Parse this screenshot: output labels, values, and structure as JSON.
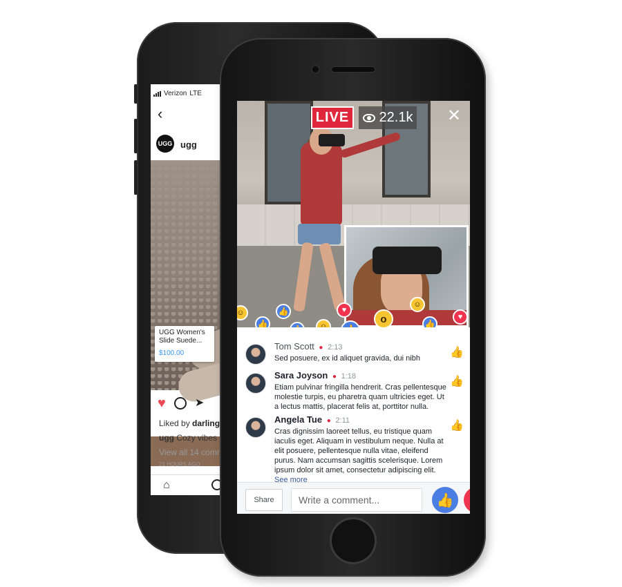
{
  "back_phone": {
    "carrier": "Verizon",
    "network": "LTE",
    "account_name": "ugg",
    "avatar_text": "UGG",
    "product_name": "UGG Women's Slide Suede...",
    "product_price": "$100.00",
    "liked_prefix": "Liked by",
    "liked_user": "darling",
    "caption_user": "ugg",
    "caption_text": "Cozy vibes",
    "view_all": "View all 14 comm",
    "time_ago": "21 HOURS AGO"
  },
  "live": {
    "badge": "LIVE",
    "viewers": "22.1k"
  },
  "comments": [
    {
      "name": "Tom Scott",
      "time": "2:13",
      "text": "Sed posuere, ex id aliquet gravida, dui nibh"
    },
    {
      "name": "Sara Joyson",
      "time": "1:18",
      "text": "Etiam pulvinar fringilla hendrerit. Cras pellentesque molestie turpis, eu pharetra quam ultricies eget. Ut a lectus mattis, placerat felis at, porttitor nulla."
    },
    {
      "name": "Angela Tue",
      "time": "2:11",
      "text": "Cras dignissim laoreet tellus, eu tristique quam iaculis eget. Aliquam in vestibulum neque. Nulla at elit posuere, pellentesque nulla vitae, eleifend purus. Nam accumsan sagittis scelerisque. Lorem ipsum dolor sit amet, consectetur adipiscing elit.",
      "see_more": "See more"
    }
  ],
  "comment_bar": {
    "share_label": "Share",
    "input_placeholder": "Write a comment..."
  },
  "colors": {
    "live_red": "#e0263d",
    "like_blue": "#4a7ee3",
    "love_red": "#f0334f",
    "insta_blue": "#3897f0"
  }
}
